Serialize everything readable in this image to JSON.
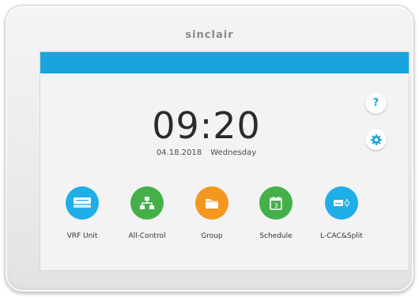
{
  "device": {
    "brand": "sinclair"
  },
  "status_bar": {
    "color": "#1aa4de"
  },
  "clock": {
    "time": "09:20",
    "date": "04.18.2018",
    "weekday": "Wednesday"
  },
  "side_buttons": [
    {
      "id": "help",
      "glyph": "?",
      "icon": "question-icon"
    },
    {
      "id": "settings",
      "icon": "gear-icon"
    }
  ],
  "tiles": [
    {
      "label": "VRF Unit",
      "icon": "vrf-unit-icon",
      "color": "#20aee8"
    },
    {
      "label": "All-Control",
      "icon": "network-hierarchy-icon",
      "color": "#45b04a"
    },
    {
      "label": "Group",
      "icon": "folder-icon",
      "color": "#f5961e"
    },
    {
      "label": "Schedule",
      "icon": "calendar-icon",
      "color": "#45b04a",
      "day": "3"
    },
    {
      "label": "L-CAC&Split",
      "icon": "split-ac-icon",
      "color": "#20aee8"
    }
  ]
}
